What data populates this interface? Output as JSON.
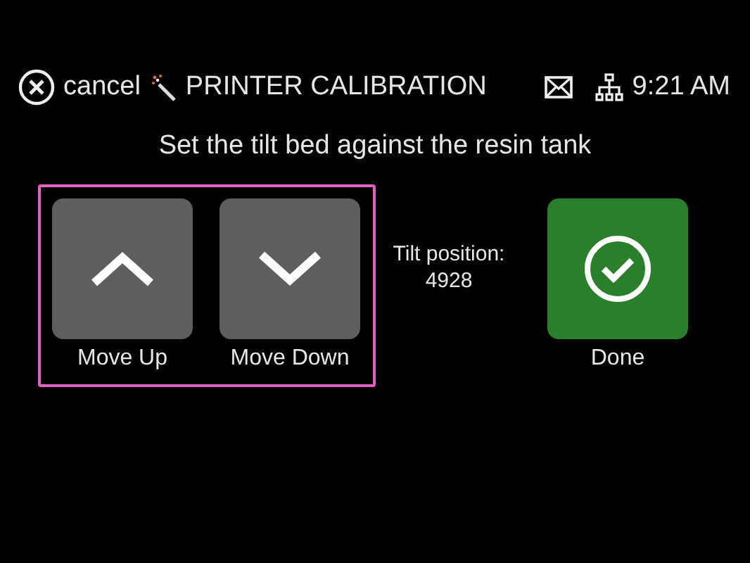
{
  "header": {
    "cancel_label": "cancel",
    "title": "PRINTER CALIBRATION",
    "time": "9:21 AM"
  },
  "instruction": "Set the tilt bed against the resin tank",
  "move_group": {
    "highlighted": true,
    "buttons": [
      {
        "kind": "up",
        "label": "Move Up"
      },
      {
        "kind": "down",
        "label": "Move Down"
      }
    ]
  },
  "tilt": {
    "label": "Tilt position:",
    "value": "4928"
  },
  "done": {
    "label": "Done"
  }
}
